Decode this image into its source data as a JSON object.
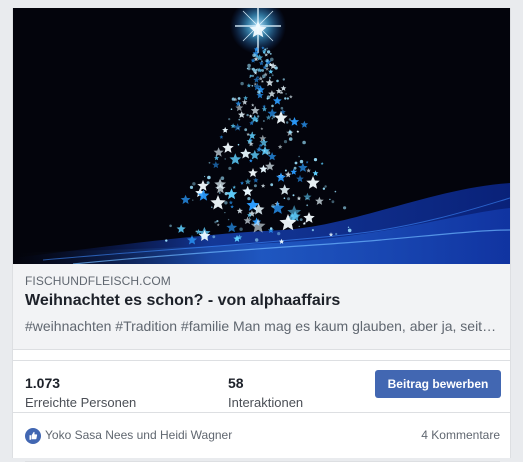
{
  "post": {
    "image_alt": "Blue glowing Christmas tree made of stars on dark background"
  },
  "link_preview": {
    "domain": "FISCHUNDFLEISCH.COM",
    "headline": "Weihnachtet es schon? - von alphaaffairs",
    "description": "#weihnachten #Tradition #familie Man mag es kaum glauben, aber ja, seit…"
  },
  "stats": {
    "reach_value": "1.073",
    "reach_label": "Erreichte Personen",
    "interactions_value": "58",
    "interactions_label": "Interaktionen"
  },
  "promote_button_label": "Beitrag bewerben",
  "footer": {
    "reaction_icon": "like-icon",
    "reactors": "Yoko Sasa Nees und Heidi Wagner",
    "comments": "4 Kommentare"
  },
  "colors": {
    "accent": "#4267b2",
    "tree_glow": "#4fc3ff",
    "background": "#03040c"
  }
}
